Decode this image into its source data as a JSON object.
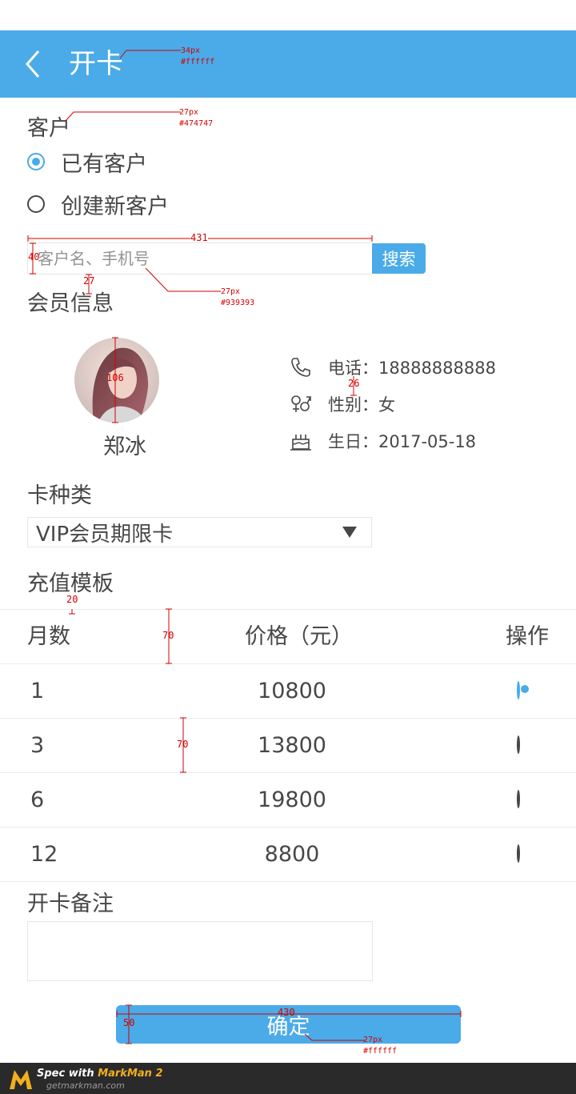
{
  "header": {
    "title": "开卡",
    "back_icon": "chevron-left-icon"
  },
  "customer": {
    "section_label": "客户",
    "options": [
      {
        "label": "已有客户",
        "checked": true
      },
      {
        "label": "创建新客户",
        "checked": false
      }
    ],
    "search": {
      "placeholder": "客户名、手机号",
      "button_label": "搜索"
    }
  },
  "member": {
    "section_label": "会员信息",
    "name": "郑冰",
    "phone": "电话：18888888888",
    "gender": "性别：女",
    "birthday": "生日：2017-05-18"
  },
  "card_type": {
    "section_label": "卡种类",
    "selected": "VIP会员期限卡"
  },
  "recharge": {
    "section_label": "充值模板",
    "columns": [
      "月数",
      "价格（元）",
      "操作"
    ],
    "rows": [
      {
        "months": "1",
        "price": "10800",
        "selected": true
      },
      {
        "months": "3",
        "price": "13800",
        "selected": false
      },
      {
        "months": "6",
        "price": "19800",
        "selected": false
      },
      {
        "months": "12",
        "price": "8800",
        "selected": false
      }
    ]
  },
  "remark": {
    "section_label": "开卡备注",
    "value": ""
  },
  "confirm": {
    "label": "确定"
  },
  "footer": {
    "title_prefix": "Spec with ",
    "title_brand": "MarkMan 2",
    "url": "getmarkman.com"
  },
  "annotations": {
    "title_size": "34px",
    "title_color": "#ffffff",
    "label_size": "27px",
    "label_color": "#474747",
    "input_width": "431",
    "input_height": "40",
    "gap_27": "27",
    "placeholder_size": "27px",
    "placeholder_color": "#939393",
    "avatar_size": "106",
    "info_gap": "26",
    "gap_20": "20",
    "head_height": "70",
    "row_height": "70",
    "button_width": "430",
    "button_height": "50",
    "button_text_size": "27px",
    "button_text_color": "#ffffff"
  },
  "colors": {
    "accent": "#4aabe8",
    "text": "#474747",
    "placeholder": "#939393"
  }
}
